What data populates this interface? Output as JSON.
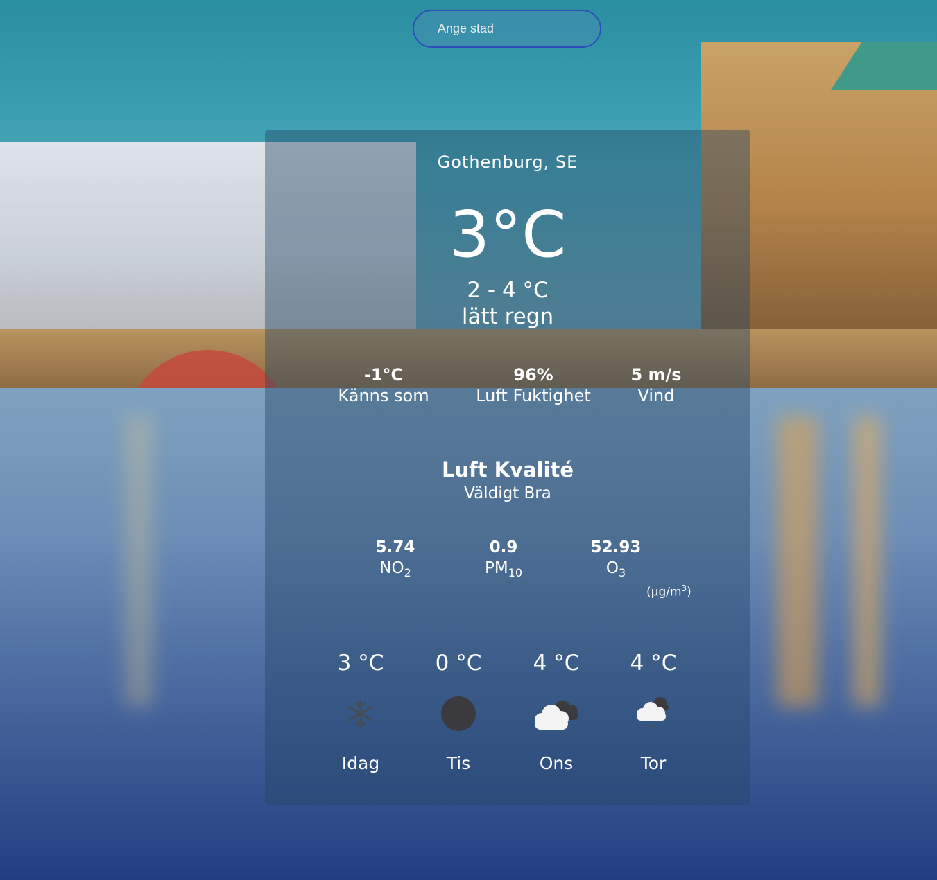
{
  "search": {
    "placeholder": "Ange stad"
  },
  "location": "Gothenburg, SE",
  "current": {
    "temp": "3°C",
    "range": "2 - 4 °C",
    "description": "lätt regn"
  },
  "stats": [
    {
      "value": "-1°C",
      "label": "Känns som"
    },
    {
      "value": "96%",
      "label": "Luft Fuktighet"
    },
    {
      "value": "5 m/s",
      "label": "Vind"
    }
  ],
  "air_quality": {
    "title": "Luft Kvalité",
    "status": "Väldigt Bra",
    "pollutants": [
      {
        "value": "5.74",
        "name": "NO",
        "sub": "2"
      },
      {
        "value": "0.9",
        "name": "PM",
        "sub": "10"
      },
      {
        "value": "52.93",
        "name": "O",
        "sub": "3"
      }
    ],
    "unit_prefix": "(µg/m",
    "unit_sup": "3",
    "unit_suffix": ")"
  },
  "forecast": [
    {
      "temp": "3 °C",
      "day": "Idag",
      "icon": "snowflake-icon"
    },
    {
      "temp": "0 °C",
      "day": "Tis",
      "icon": "dark-moon-icon"
    },
    {
      "temp": "4 °C",
      "day": "Ons",
      "icon": "cloud-icon"
    },
    {
      "temp": "4 °C",
      "day": "Tor",
      "icon": "cloud-rain-icon"
    }
  ]
}
